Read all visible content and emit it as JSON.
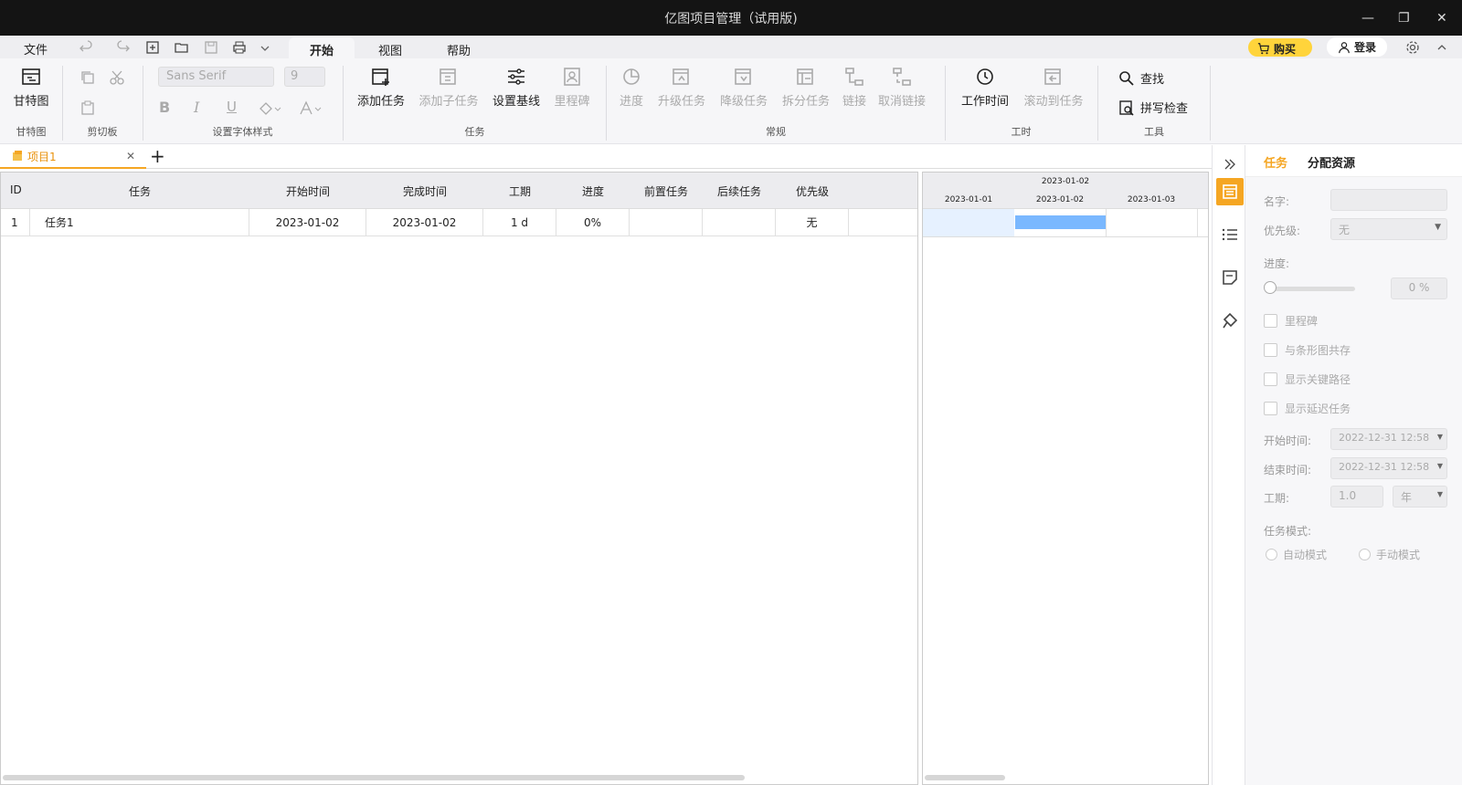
{
  "window": {
    "title": "亿图项目管理（试用版)"
  },
  "menu": {
    "file": "文件"
  },
  "tabs": [
    "开始",
    "视图",
    "帮助"
  ],
  "buy_label": "购买",
  "login_label": "登录",
  "ribbon": {
    "gantt": {
      "label": "甘特图",
      "group": "甘特图"
    },
    "clipboard": {
      "group": "剪切板"
    },
    "font": {
      "family": "Sans Serif",
      "size": "9",
      "group": "设置字体样式"
    },
    "task": {
      "add": "添加任务",
      "add_sub": "添加子任务",
      "baseline": "设置基线",
      "milestone": "里程碑",
      "group": "任务"
    },
    "general": {
      "progress": "进度",
      "upgrade": "升级任务",
      "downgrade": "降级任务",
      "split": "拆分任务",
      "link": "链接",
      "unlink": "取消链接",
      "group": "常规"
    },
    "hours": {
      "work_time": "工作时间",
      "scroll_to": "滚动到任务",
      "group": "工时"
    },
    "tools": {
      "find": "查找",
      "spell": "拼写检查",
      "group": "工具"
    }
  },
  "doc_tab": {
    "name": "项目1"
  },
  "grid": {
    "headers": [
      "ID",
      "任务",
      "开始时间",
      "完成时间",
      "工期",
      "进度",
      "前置任务",
      "后续任务",
      "优先级"
    ],
    "rows": [
      {
        "id": "1",
        "task": "任务1",
        "start": "2023-01-02",
        "end": "2023-01-02",
        "duration": "1 d",
        "progress": "0%",
        "pred": "",
        "succ": "",
        "priority": "无"
      }
    ]
  },
  "gantt": {
    "top_date": "2023-01-02",
    "days": [
      "2023-01-01",
      "2023-01-02",
      "2023-01-03"
    ],
    "bar_color": "#7ab8ff"
  },
  "panel": {
    "tab_task": "任务",
    "tab_resource": "分配资源",
    "name_label": "名字:",
    "name_value": "",
    "priority_label": "优先级:",
    "priority_value": "无",
    "progress_label": "进度:",
    "progress_value": "0 %",
    "checks": [
      "里程碑",
      "与条形图共存",
      "显示关键路径",
      "显示延迟任务"
    ],
    "start_label": "开始时间:",
    "start_value": "2022-12-31 12:58",
    "end_label": "结束时间:",
    "end_value": "2022-12-31 12:58",
    "duration_label": "工期:",
    "duration_value": "1.0",
    "duration_unit": "年",
    "mode_label": "任务模式:",
    "mode_auto": "自动模式",
    "mode_manual": "手动模式"
  },
  "colors": {
    "accent": "#f5a623",
    "buy": "#ffd43b",
    "titlebar": "#141414"
  }
}
